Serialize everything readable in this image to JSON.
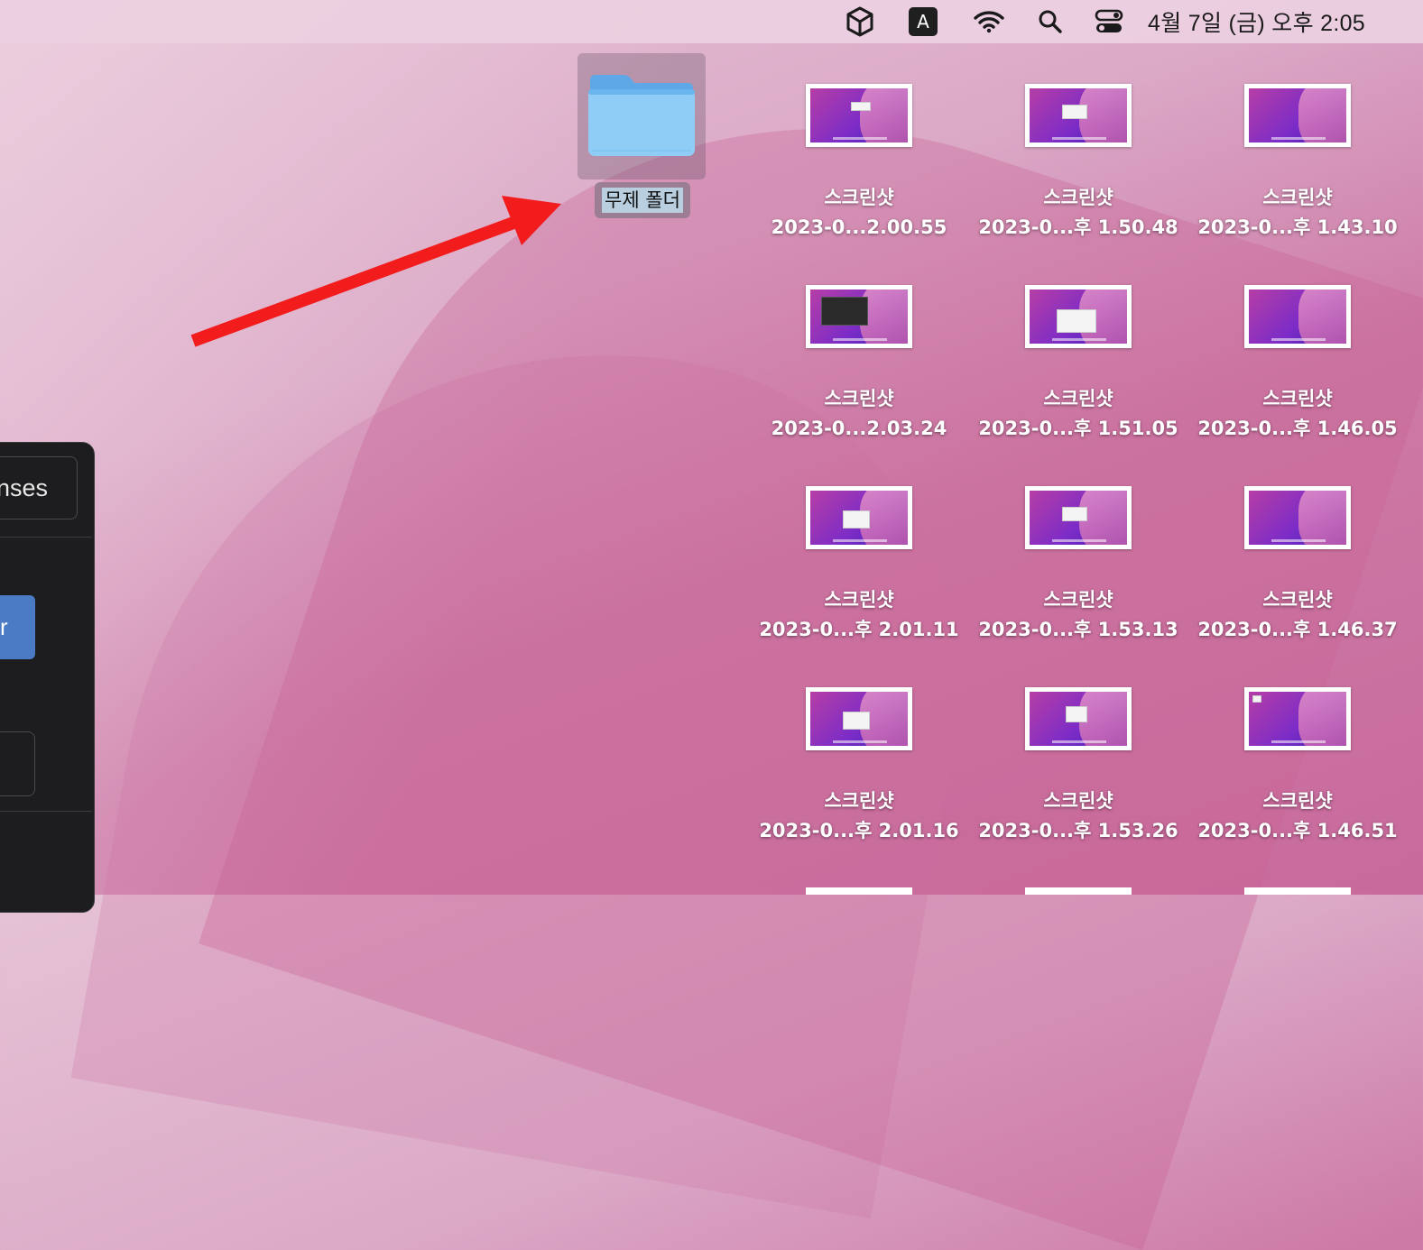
{
  "menubar": {
    "icons": [
      "unity-icon",
      "input-source-icon",
      "wifi-icon",
      "search-icon",
      "control-center-icon"
    ],
    "input_source_label": "A",
    "clock": "4월 7일 (금) 오후  2:05"
  },
  "desktop": {
    "folder": {
      "name": "무제 폴더",
      "selected": true,
      "icon": "folder-icon"
    },
    "arrow_color": "#f21c1c",
    "files": [
      {
        "line1": "스크린샷",
        "line2": "2023-0...2.00.55"
      },
      {
        "line1": "스크린샷",
        "line2": "2023-0...후 1.50.48"
      },
      {
        "line1": "스크린샷",
        "line2": "2023-0...후 1.43.10"
      },
      {
        "line1": "스크린샷",
        "line2": "2023-0...2.03.24"
      },
      {
        "line1": "스크린샷",
        "line2": "2023-0...후 1.51.05"
      },
      {
        "line1": "스크린샷",
        "line2": "2023-0...후 1.46.05"
      },
      {
        "line1": "스크린샷",
        "line2": "2023-0...후 2.01.11"
      },
      {
        "line1": "스크린샷",
        "line2": "2023-0...후 1.53.13"
      },
      {
        "line1": "스크린샷",
        "line2": "2023-0...후 1.46.37"
      },
      {
        "line1": "스크린샷",
        "line2": "2023-0...후 2.01.16"
      },
      {
        "line1": "스크린샷",
        "line2": "2023-0...후 1.53.26"
      },
      {
        "line1": "스크린샷",
        "line2": "2023-0...후 1.46.51"
      }
    ]
  },
  "panel": {
    "tab_label": "nses",
    "button_label": "r"
  }
}
